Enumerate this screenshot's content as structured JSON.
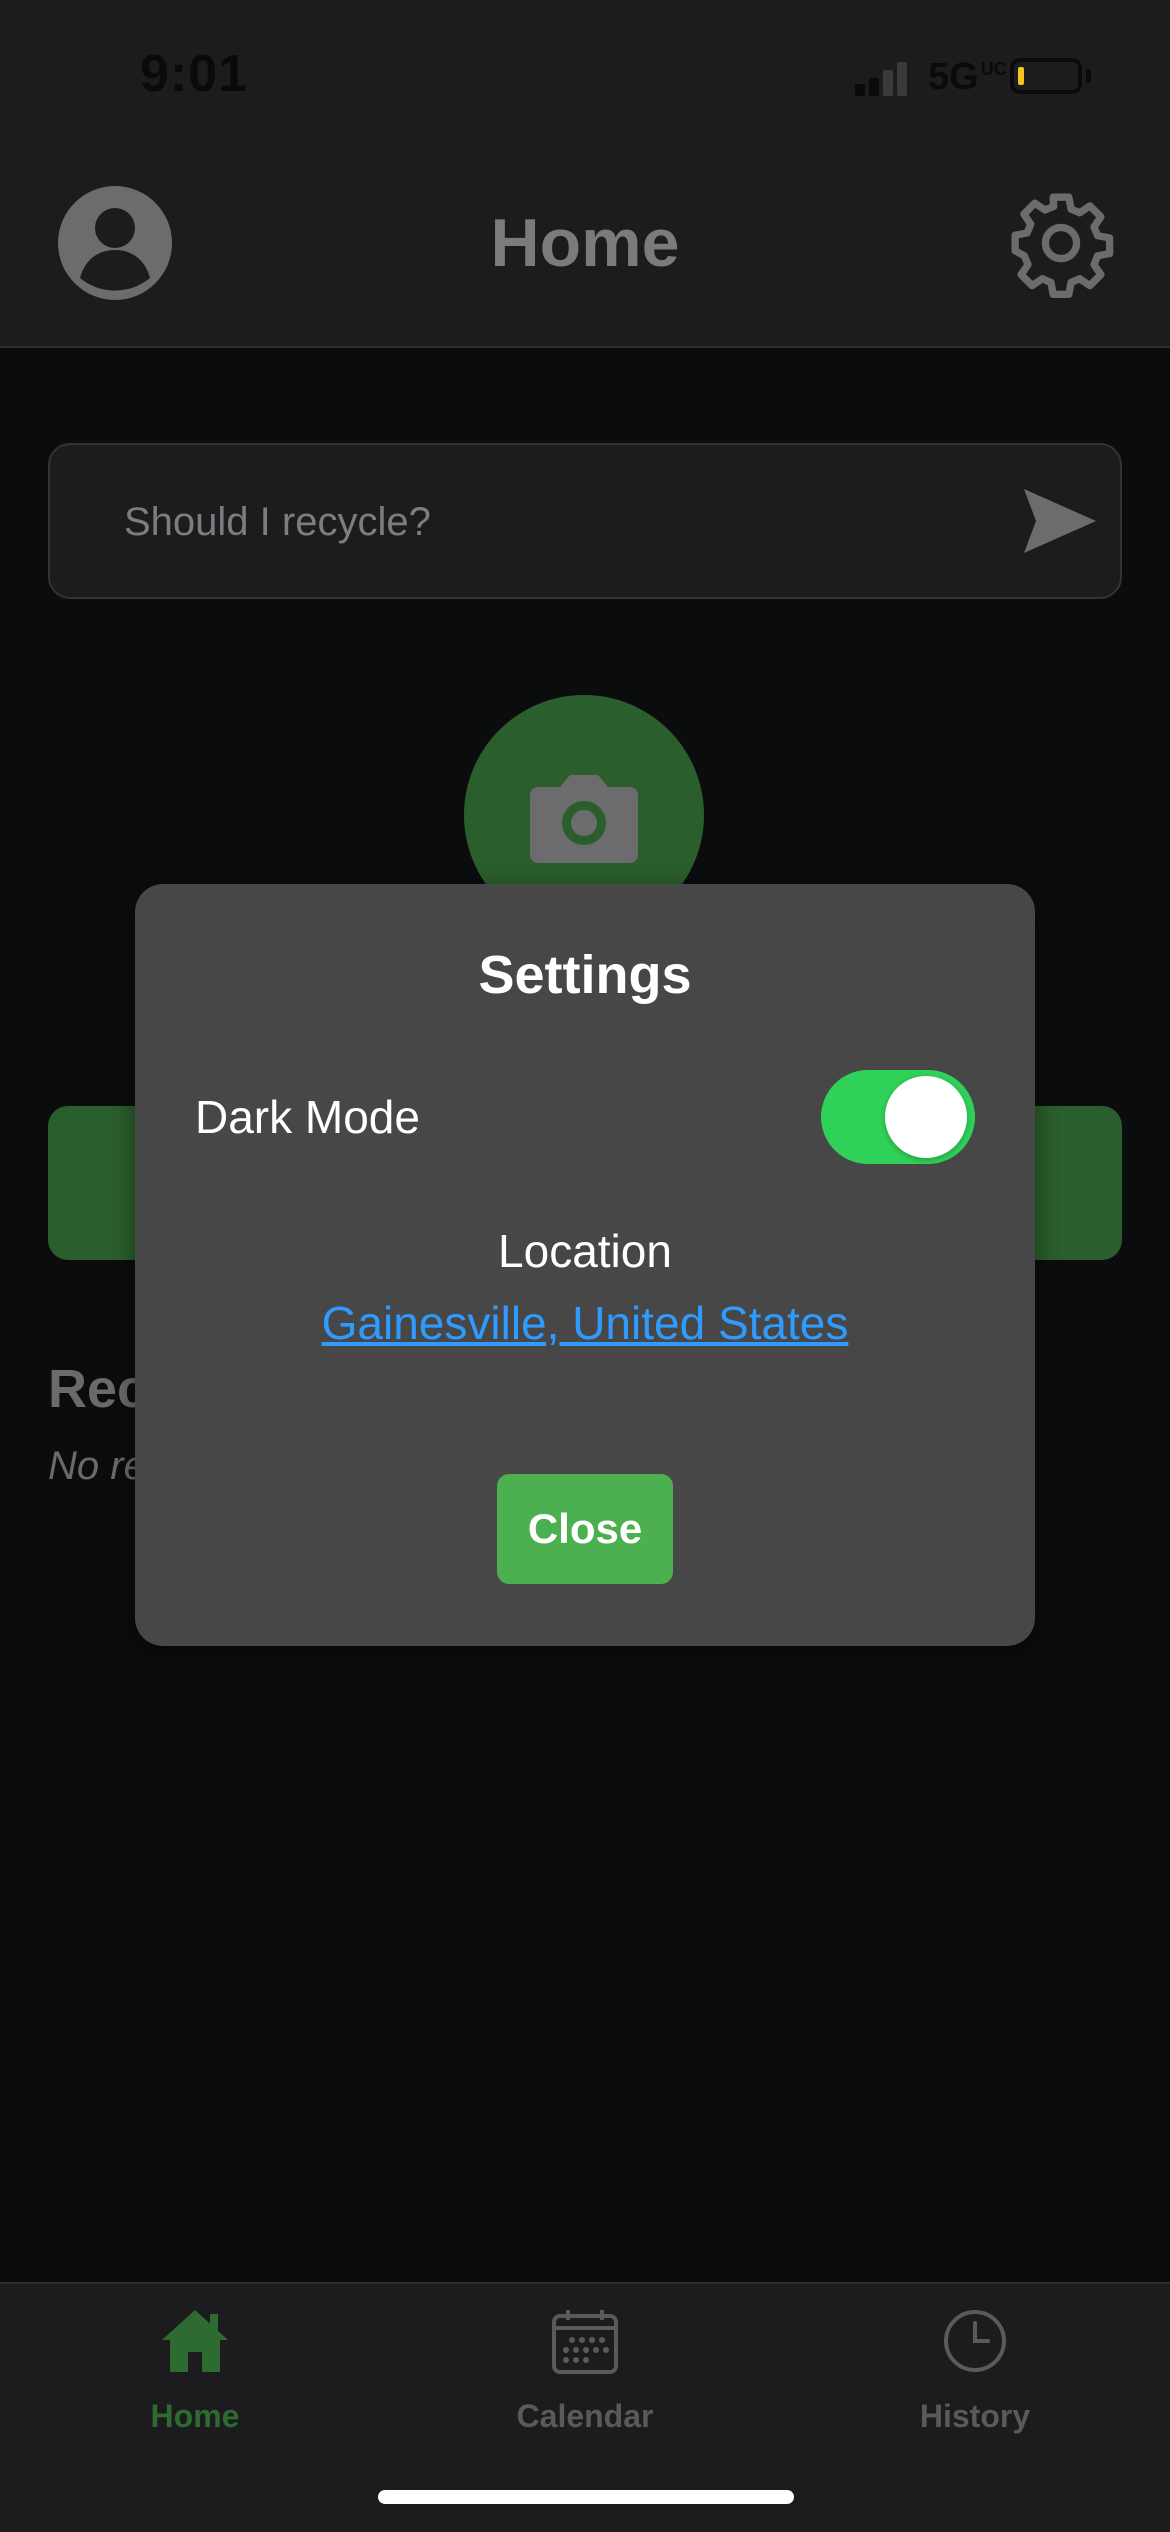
{
  "status_bar": {
    "time": "9:01",
    "network": "5G",
    "network_superscript": "UC",
    "battery_color": "#f5c518"
  },
  "header": {
    "title": "Home",
    "profile_icon": "user-circle-icon",
    "settings_icon": "gear-icon"
  },
  "search": {
    "placeholder": "Should I recycle?",
    "send_icon": "send-arrow-icon"
  },
  "camera": {
    "icon": "camera-icon",
    "color": "#2a5e2c"
  },
  "background": {
    "recent_heading": "Rec",
    "recent_empty": "No re"
  },
  "settings_modal": {
    "title": "Settings",
    "dark_mode_label": "Dark Mode",
    "dark_mode_enabled": true,
    "toggle_color": "#30d158",
    "location_label": "Location",
    "location_value": "Gainesville, United States",
    "link_color": "#2f9bff",
    "close_label": "Close",
    "close_color": "#4caf50"
  },
  "tab_bar": {
    "active_color": "#2e6b30",
    "inactive_color": "#5a5a5c",
    "tabs": [
      {
        "label": "Home",
        "icon": "home-icon",
        "active": true
      },
      {
        "label": "Calendar",
        "icon": "calendar-icon",
        "active": false
      },
      {
        "label": "History",
        "icon": "clock-icon",
        "active": false
      }
    ]
  }
}
